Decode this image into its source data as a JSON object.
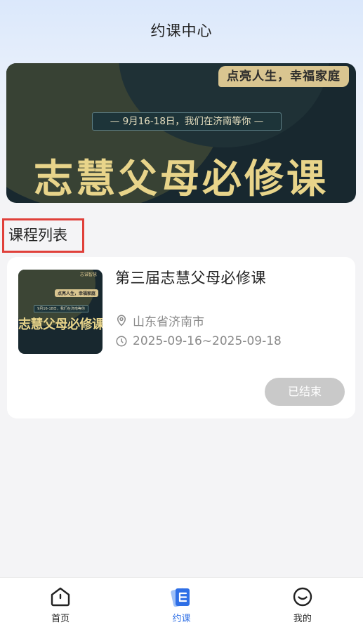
{
  "header": {
    "title": "约课中心"
  },
  "banner": {
    "tagline": "点亮人生，幸福家庭",
    "date_text": "— 9月16-18日，我们在济南等你 —",
    "headline": "志慧父母必修课"
  },
  "section": {
    "title": "课程列表"
  },
  "courses": [
    {
      "thumb_tag": "点亮人生，幸福家庭",
      "thumb_corner": "志诚智慧",
      "thumb_date": "9月16-18日，我们在济南等你",
      "thumb_headline": "志慧父母必修课",
      "title": "第三届志慧父母必修课",
      "location": "山东省济南市",
      "date_range": "2025-09-16~2025-09-18",
      "status": "已结束"
    }
  ],
  "tabbar": {
    "items": [
      {
        "label": "首页",
        "icon": "home-icon",
        "active": false
      },
      {
        "label": "约课",
        "icon": "course-book-icon",
        "active": true
      },
      {
        "label": "我的",
        "icon": "profile-smile-icon",
        "active": false
      }
    ]
  },
  "colors": {
    "accent": "#2f6fe6",
    "banner_bg": "#18282f",
    "banner_gold": "#e8d48a",
    "highlight_border": "#e0403a",
    "status_bg": "#c9c9c9"
  }
}
